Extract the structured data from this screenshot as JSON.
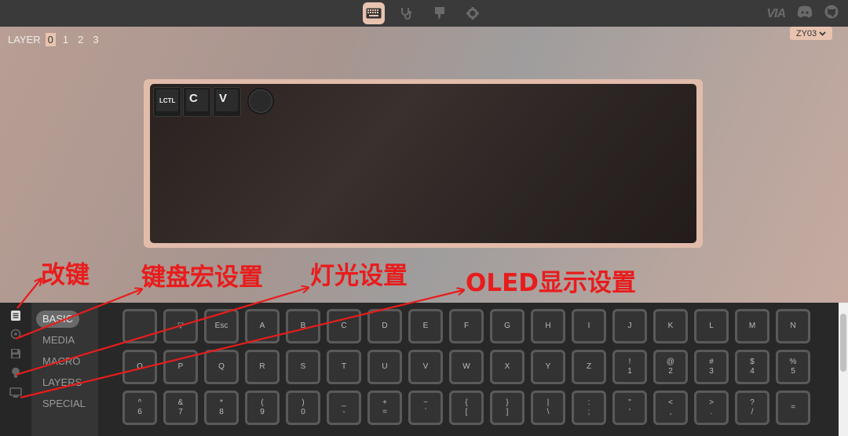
{
  "topbar": {
    "nav_icons": [
      "keyboard-icon",
      "stethoscope-icon",
      "design-icon",
      "gear-icon"
    ],
    "via_logo": "VIA",
    "right_icons": [
      "discord-icon",
      "github-icon"
    ]
  },
  "layers": {
    "label": "LAYER",
    "items": [
      "0",
      "1",
      "2",
      "3"
    ],
    "active": "0"
  },
  "keyboard_select": {
    "value": "ZY03"
  },
  "keyboard": {
    "keys": [
      "LCTL",
      "C",
      "V"
    ]
  },
  "categories": [
    "BASIC",
    "MEDIA",
    "MACRO",
    "LAYERS",
    "SPECIAL"
  ],
  "active_category": "BASIC",
  "keycodes": {
    "row1": [
      [
        "",
        ""
      ],
      [
        "▽",
        ""
      ],
      [
        "Esc",
        ""
      ],
      [
        "A",
        ""
      ],
      [
        "B",
        ""
      ],
      [
        "C",
        ""
      ],
      [
        "D",
        ""
      ],
      [
        "E",
        ""
      ],
      [
        "F",
        ""
      ],
      [
        "G",
        ""
      ],
      [
        "H",
        ""
      ],
      [
        "I",
        ""
      ],
      [
        "J",
        ""
      ],
      [
        "K",
        ""
      ],
      [
        "L",
        ""
      ],
      [
        "M",
        ""
      ],
      [
        "N",
        ""
      ]
    ],
    "row2": [
      [
        "O",
        ""
      ],
      [
        "P",
        ""
      ],
      [
        "Q",
        ""
      ],
      [
        "R",
        ""
      ],
      [
        "S",
        ""
      ],
      [
        "T",
        ""
      ],
      [
        "U",
        ""
      ],
      [
        "V",
        ""
      ],
      [
        "W",
        ""
      ],
      [
        "X",
        ""
      ],
      [
        "Y",
        ""
      ],
      [
        "Z",
        ""
      ],
      [
        "!",
        "1"
      ],
      [
        "@",
        "2"
      ],
      [
        "#",
        "3"
      ],
      [
        "$",
        "4"
      ],
      [
        "%",
        "5"
      ]
    ],
    "row3": [
      [
        "^",
        "6"
      ],
      [
        "&",
        "7"
      ],
      [
        "*",
        "8"
      ],
      [
        "(",
        "9"
      ],
      [
        ")",
        "0"
      ],
      [
        "_",
        "-"
      ],
      [
        "+",
        "="
      ],
      [
        "~",
        "`"
      ],
      [
        "{",
        "["
      ],
      [
        "}",
        "]"
      ],
      [
        "|",
        "\\"
      ],
      [
        ":",
        ";"
      ],
      [
        "\"",
        "'"
      ],
      [
        "<",
        ","
      ],
      [
        ">",
        "."
      ],
      [
        "?",
        "/"
      ],
      [
        "=",
        ""
      ]
    ]
  },
  "annotations": {
    "remap": "改键",
    "macro": "键盘宏设置",
    "lighting": "灯光设置",
    "oled": "OLED显示设置"
  },
  "colors": {
    "accent": "#e8c4b0",
    "annotation": "#e81c1c"
  }
}
